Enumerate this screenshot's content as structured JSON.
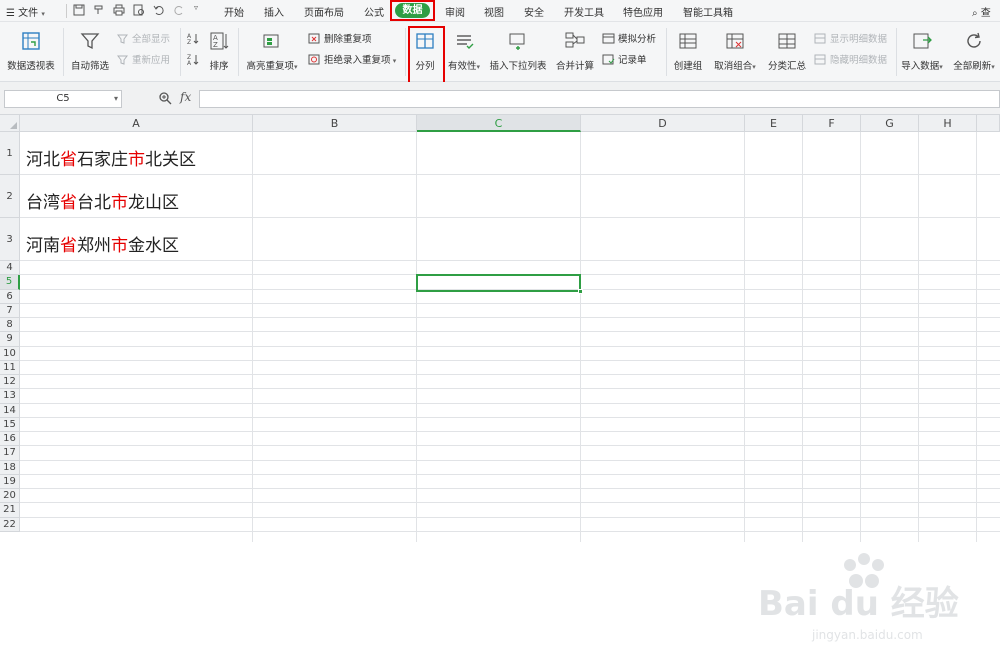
{
  "menubar": {
    "hamburger_label": "文件",
    "tabs": [
      "开始",
      "插入",
      "页面布局",
      "公式",
      "数据",
      "审阅",
      "视图",
      "安全",
      "开发工具",
      "特色应用",
      "智能工具箱"
    ],
    "search_label": "查"
  },
  "ribbon": {
    "pivot": "数据透视表",
    "autofilter": "自动筛选",
    "show_all": "全部显示",
    "reapply": "重新应用",
    "sort": "排序",
    "highlight_dup": "高亮重复项",
    "delete_dup": "删除重复项",
    "reject_dup": "拒绝录入重复项",
    "split": "分列",
    "validity": "有效性",
    "insert_dropdown": "插入下拉列表",
    "consolidate": "合并计算",
    "whatif": "模拟分析",
    "record": "记录单",
    "create_group": "创建组",
    "ungroup": "取消组合",
    "subtotal": "分类汇总",
    "show_detail": "显示明细数据",
    "hide_detail": "隐藏明细数据",
    "import": "导入数据",
    "refresh_all": "全部刷新"
  },
  "formula_bar": {
    "name_box": "C5",
    "fx": "fx",
    "formula": ""
  },
  "sheet": {
    "columns": [
      "A",
      "B",
      "C",
      "D",
      "E",
      "F",
      "G",
      "H"
    ],
    "rows": [
      "1",
      "2",
      "3",
      "4",
      "5",
      "6",
      "7",
      "8",
      "9",
      "10",
      "11",
      "12",
      "13",
      "14",
      "15",
      "16",
      "17",
      "18",
      "19",
      "20",
      "21",
      "22"
    ],
    "cells": [
      {
        "row": 1,
        "parts": [
          {
            "t": "河北",
            "red": false
          },
          {
            "t": "省",
            "red": true
          },
          {
            "t": "石家庄",
            "red": false
          },
          {
            "t": "市",
            "red": true
          },
          {
            "t": "北关区",
            "red": false
          }
        ]
      },
      {
        "row": 2,
        "parts": [
          {
            "t": "台湾",
            "red": false
          },
          {
            "t": "省",
            "red": true
          },
          {
            "t": "台北",
            "red": false
          },
          {
            "t": "市",
            "red": true
          },
          {
            "t": "龙山区",
            "red": false
          }
        ]
      },
      {
        "row": 3,
        "parts": [
          {
            "t": "河南",
            "red": false
          },
          {
            "t": "省",
            "red": true
          },
          {
            "t": "郑州",
            "red": false
          },
          {
            "t": "市",
            "red": true
          },
          {
            "t": "金水区",
            "red": false
          }
        ]
      }
    ],
    "active_cell": "C5"
  },
  "watermark": {
    "logo": "Bai du 经验",
    "url": "jingyan.baidu.com"
  },
  "colors": {
    "accent": "#2f9e44",
    "highlight_box": "#e60000",
    "red_text": "#e60000"
  }
}
